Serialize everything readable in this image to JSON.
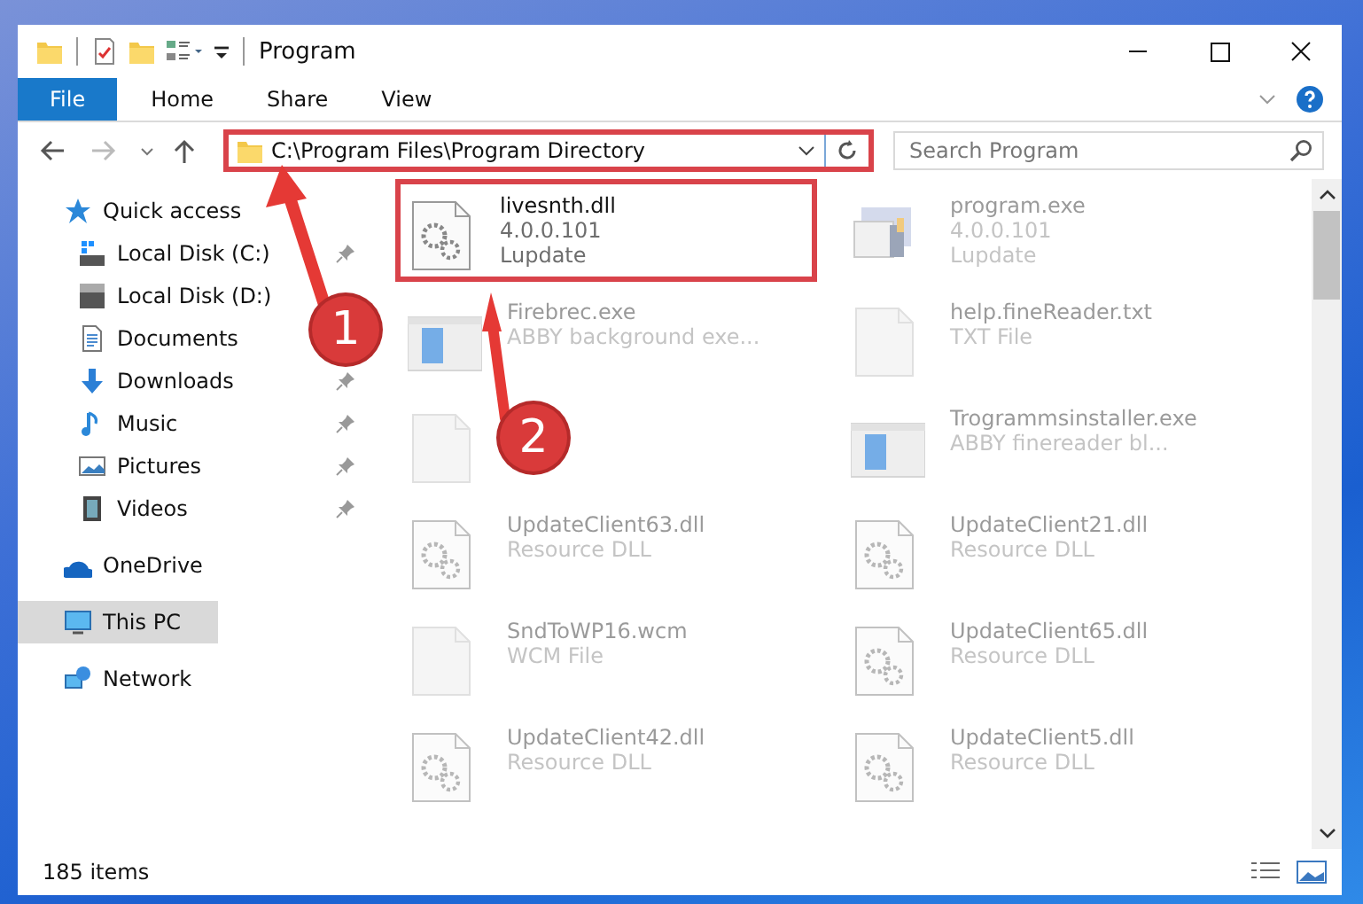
{
  "window": {
    "title": "Program"
  },
  "ribbon_tabs": [
    {
      "label": "File",
      "selected": true
    },
    {
      "label": "Home",
      "selected": false
    },
    {
      "label": "Share",
      "selected": false
    },
    {
      "label": "View",
      "selected": false
    }
  ],
  "address_bar": {
    "value": "C:\\Program Files\\Program Directory",
    "highlighted": true
  },
  "search": {
    "placeholder": "Search Program"
  },
  "nav": {
    "items": [
      {
        "label": "Quick access",
        "kind": "star",
        "selected": false,
        "children": [
          {
            "label": "Local Disk (C:)",
            "kind": "system-drive",
            "pinned": true,
            "selected": false
          },
          {
            "label": "Local Disk (D:)",
            "kind": "drive",
            "pinned": false,
            "selected": false
          },
          {
            "label": "Documents",
            "kind": "documents",
            "pinned": false,
            "selected": false
          },
          {
            "label": "Downloads",
            "kind": "downloads",
            "pinned": true,
            "selected": false
          },
          {
            "label": "Music",
            "kind": "music",
            "pinned": true,
            "selected": false
          },
          {
            "label": "Pictures",
            "kind": "pictures",
            "pinned": true,
            "selected": false
          },
          {
            "label": "Videos",
            "kind": "videos",
            "pinned": true,
            "selected": false
          }
        ]
      },
      {
        "label": "OneDrive",
        "kind": "cloud",
        "selected": false
      },
      {
        "label": "This PC",
        "kind": "computer",
        "selected": true
      },
      {
        "label": "Network",
        "kind": "network",
        "selected": false
      }
    ]
  },
  "files": [
    {
      "name": "livesnth.dll",
      "details": [
        "4.0.0.101",
        "Lupdate"
      ],
      "kind": "dll",
      "dimmed": false,
      "highlighted": true
    },
    {
      "name": "program.exe",
      "details": [
        "4.0.0.101",
        "Lupdate"
      ],
      "kind": "program",
      "dimmed": true,
      "highlighted": false
    },
    {
      "name": "Firebrec.exe",
      "details": [
        "ABBY background exe..."
      ],
      "kind": "app",
      "dimmed": true,
      "highlighted": false
    },
    {
      "name": "help.fineReader.txt",
      "details": [
        "TXT File"
      ],
      "kind": "blank",
      "dimmed": true,
      "highlighted": false
    },
    {
      "kind": "blank",
      "dimmed": true,
      "highlighted": false
    },
    {
      "name": "Trogrammsinstaller.exe",
      "details": [
        "ABBY finereader bl..."
      ],
      "kind": "app",
      "dimmed": true,
      "highlighted": false
    },
    {
      "name": "UpdateClient63.dll",
      "details": [
        "Resource DLL"
      ],
      "kind": "dll",
      "dimmed": true,
      "highlighted": false
    },
    {
      "name": "UpdateClient21.dll",
      "details": [
        "Resource DLL"
      ],
      "kind": "dll",
      "dimmed": true,
      "highlighted": false
    },
    {
      "name": "SndToWP16.wcm",
      "details": [
        "WCM File"
      ],
      "kind": "blank",
      "dimmed": true,
      "highlighted": false
    },
    {
      "name": "UpdateClient65.dll",
      "details": [
        "Resource DLL"
      ],
      "kind": "dll",
      "dimmed": true,
      "highlighted": false
    },
    {
      "name": "UpdateClient42.dll",
      "details": [
        "Resource DLL"
      ],
      "kind": "dll",
      "dimmed": true,
      "highlighted": false
    },
    {
      "name": "UpdateClient5.dll",
      "details": [
        "Resource DLL"
      ],
      "kind": "dll",
      "dimmed": true,
      "highlighted": false
    }
  ],
  "markers": [
    {
      "label": "1"
    },
    {
      "label": "2"
    }
  ],
  "status_bar": {
    "item_count": "185 items"
  }
}
